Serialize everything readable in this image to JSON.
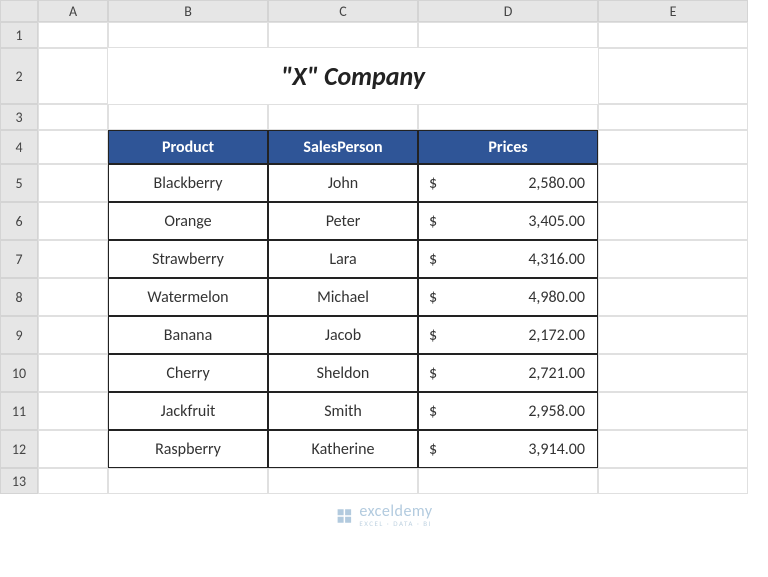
{
  "columns": [
    "A",
    "B",
    "C",
    "D",
    "E"
  ],
  "rows": [
    "1",
    "2",
    "3",
    "4",
    "5",
    "6",
    "7",
    "8",
    "9",
    "10",
    "11",
    "12",
    "13"
  ],
  "title": "\"X\" Company",
  "headers": {
    "product": "Product",
    "salesperson": "SalesPerson",
    "prices": "Prices"
  },
  "data": [
    {
      "product": "Blackberry",
      "salesperson": "John",
      "currency": "$",
      "price": "2,580.00"
    },
    {
      "product": "Orange",
      "salesperson": "Peter",
      "currency": "$",
      "price": "3,405.00"
    },
    {
      "product": "Strawberry",
      "salesperson": "Lara",
      "currency": "$",
      "price": "4,316.00"
    },
    {
      "product": "Watermelon",
      "salesperson": "Michael",
      "currency": "$",
      "price": "4,980.00"
    },
    {
      "product": "Banana",
      "salesperson": "Jacob",
      "currency": "$",
      "price": "2,172.00"
    },
    {
      "product": "Cherry",
      "salesperson": "Sheldon",
      "currency": "$",
      "price": "2,721.00"
    },
    {
      "product": "Jackfruit",
      "salesperson": "Smith",
      "currency": "$",
      "price": "2,958.00"
    },
    {
      "product": "Raspberry",
      "salesperson": "Katherine",
      "currency": "$",
      "price": "3,914.00"
    }
  ],
  "watermark": {
    "main": "exceldemy",
    "sub": "EXCEL · DATA · BI"
  }
}
